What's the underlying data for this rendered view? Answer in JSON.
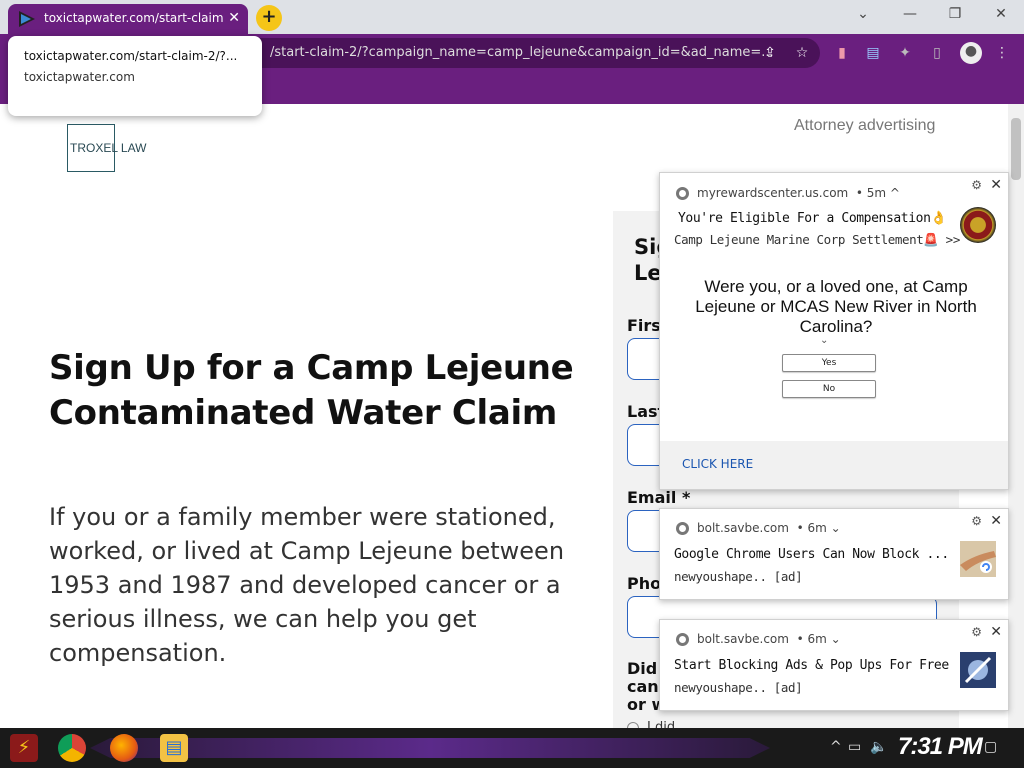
{
  "browser": {
    "tab_title": "toxictapwater.com/start-claim",
    "tab_close": "✕",
    "new_tab": "+",
    "url": "/start-claim-2/?campaign_name=camp_lejeune&campaign_id=&ad_name=...",
    "tooltip": {
      "url_line": "toxictapwater.com/start-claim-2/?...",
      "domain": "toxictapwater.com"
    },
    "window_buttons": {
      "dropdown": "⌄",
      "minimize": "—",
      "restore": "❐",
      "close": "✕"
    },
    "icons": [
      "share-icon",
      "star-icon",
      "extension-icon",
      "reader-icon",
      "puzzle-icon",
      "sidebar-icon",
      "profile-icon",
      "menu-icon"
    ]
  },
  "page": {
    "logo_text": "TROXEL LAW",
    "attorney_advertising": "Attorney advertising",
    "headline": "Sign Up for a Camp Lejeune Contaminated Water Claim",
    "subcopy": "If you or a family member were stationed, worked, or lived at Camp Lejeune between 1953 and 1987 and developed cancer or a serious illness, we can help you get compensation.",
    "form": {
      "title_partial": "Sig\nLe",
      "first_label": "First",
      "last_label": "Last",
      "email_label": "Email *",
      "phone_label": "Pho",
      "question_partial": "Did\ncanc\nor w",
      "radio_label": "I did"
    }
  },
  "notifications": [
    {
      "source": "myrewardscenter.us.com",
      "time": "• 5m ^",
      "title": "You're Eligible For a Compensation👌",
      "subtitle": "Camp Lejeune Marine Corp Settlement🚨 >>",
      "question": "Were you, or a loved one, at Camp Lejeune or MCAS New River in North Carolina?",
      "chevron": "⌄",
      "yes": "Yes",
      "no": "No",
      "cta": "CLICK HERE"
    },
    {
      "source": "bolt.savbe.com",
      "time": "• 6m ⌄",
      "title": "Google Chrome Users Can Now Block ...",
      "subtitle": "newyoushape.. [ad]"
    },
    {
      "source": "bolt.savbe.com",
      "time": "• 6m ⌄",
      "title": "Start Blocking Ads & Pop Ups For Free",
      "subtitle": "newyoushape.. [ad]"
    }
  ],
  "taskbar": {
    "clock": "7:31 PM",
    "apps": [
      "start-icon",
      "chrome-icon",
      "firefox-icon",
      "file-explorer-icon"
    ]
  }
}
